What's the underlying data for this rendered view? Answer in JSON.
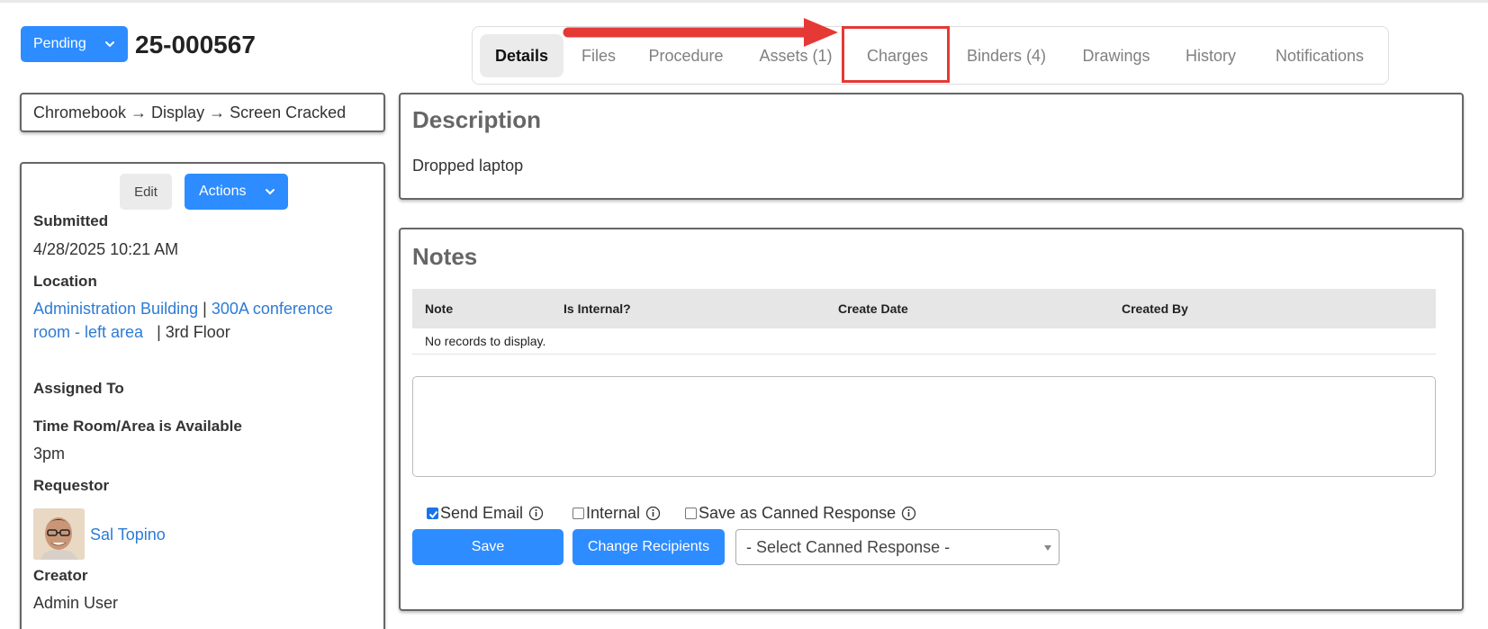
{
  "header": {
    "status_label": "Pending",
    "ticket_number": "25-000567"
  },
  "tabs": [
    {
      "label": "Details",
      "active": true
    },
    {
      "label": "Files"
    },
    {
      "label": "Procedure"
    },
    {
      "label": "Assets (1)"
    },
    {
      "label": "Charges"
    },
    {
      "label": "Binders (4)"
    },
    {
      "label": "Drawings"
    },
    {
      "label": "History"
    },
    {
      "label": "Notifications"
    }
  ],
  "breadcrumb": "Chromebook → Display → Screen Cracked",
  "info": {
    "edit_label": "Edit",
    "actions_label": "Actions",
    "submitted_label": "Submitted",
    "submitted_value": "4/28/2025 10:21 AM",
    "location_label": "Location",
    "location_building": "Administration Building",
    "location_separator": "|",
    "location_room_line1": "300A conference",
    "location_room_line2": "room - left area",
    "location_floor": "| 3rd Floor",
    "assigned_label": "Assigned To",
    "time_label": "Time Room/Area is Available",
    "time_value": "3pm",
    "requestor_label": "Requestor",
    "requestor_name": "Sal Topino",
    "creator_label": "Creator",
    "creator_value": "Admin User"
  },
  "description": {
    "title": "Description",
    "text": "Dropped laptop"
  },
  "notes": {
    "title": "Notes",
    "columns": [
      "Note",
      "Is Internal?",
      "Create Date",
      "Created By"
    ],
    "empty_text": "No records to display.",
    "send_email_label": "Send Email",
    "internal_label": "Internal",
    "canned_label": "Save as Canned Response",
    "save_label": "Save",
    "change_recipients_label": "Change Recipients",
    "canned_select_value": "- Select Canned Response -"
  },
  "colors": {
    "primary": "#2d8cff",
    "highlight": "#e53935",
    "link": "#2d7bd6"
  }
}
